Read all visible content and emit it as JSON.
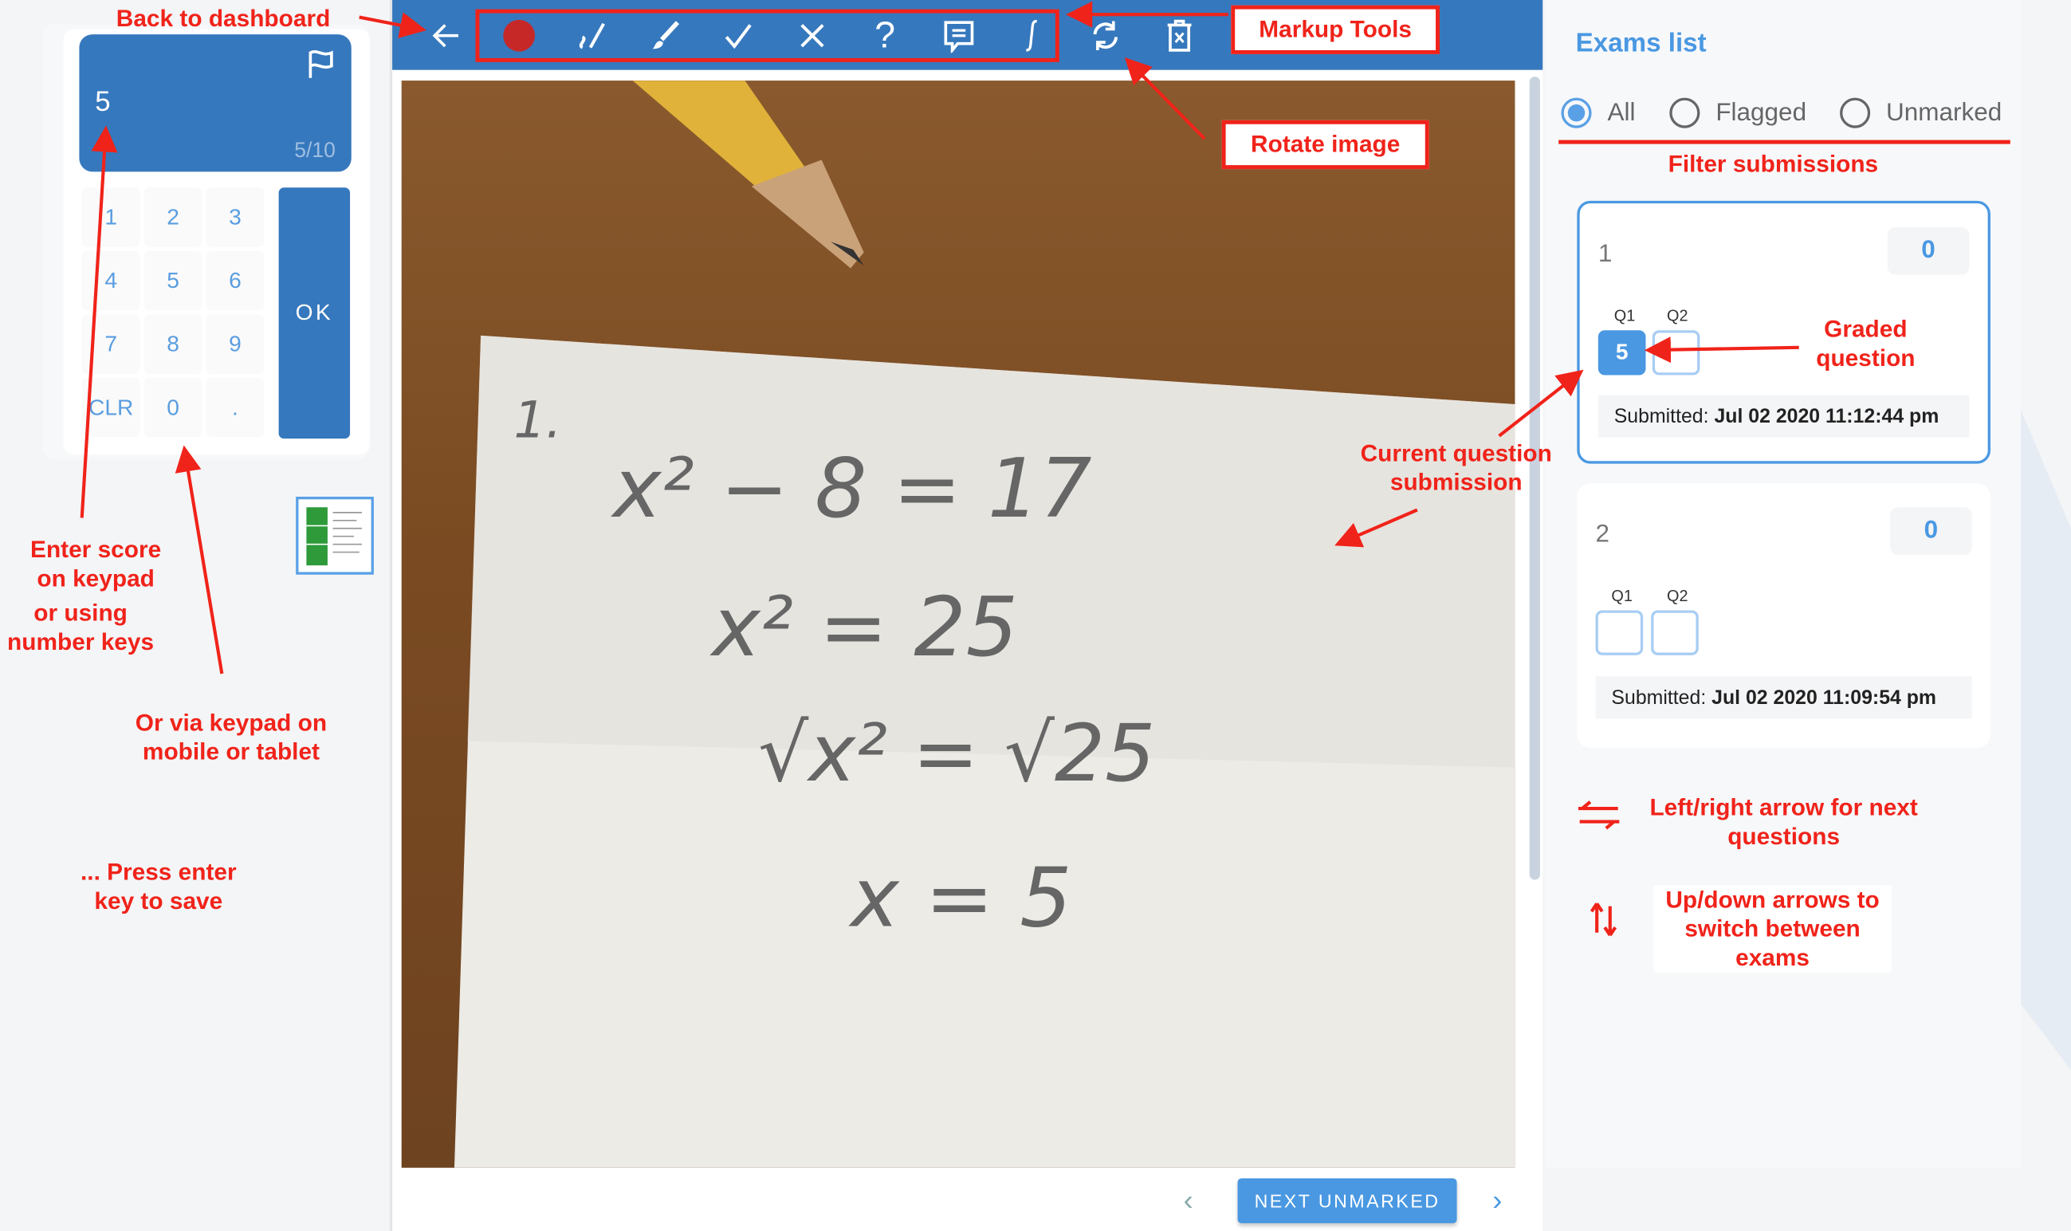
{
  "keypad": {
    "current_value": "5",
    "progress": "5/10",
    "keys": [
      "1",
      "2",
      "3",
      "4",
      "5",
      "6",
      "7",
      "8",
      "9",
      "CLR",
      "0",
      "."
    ],
    "ok_label": "OK"
  },
  "toolbar": {
    "icons": [
      "back-arrow-icon",
      "red-dot-icon",
      "check-pen-icon",
      "brush-icon",
      "check-icon",
      "cross-icon",
      "question-icon",
      "comment-icon",
      "integral-icon",
      "rotate-icon",
      "delete-icon"
    ],
    "marker_color": "#c62828"
  },
  "submission": {
    "lines": [
      "1.",
      "x² − 8 = 17",
      "x² = 25",
      "√x² = √25",
      "x = 5"
    ]
  },
  "footer": {
    "next_label": "NEXT UNMARKED"
  },
  "exams": {
    "title": "Exams list",
    "filters": [
      {
        "label": "All",
        "selected": true
      },
      {
        "label": "Flagged",
        "selected": false
      },
      {
        "label": "Unmarked",
        "selected": false
      }
    ],
    "cards": [
      {
        "number": "1",
        "score": "0",
        "questions": [
          {
            "label": "Q1",
            "value": "5",
            "graded": true
          },
          {
            "label": "Q2",
            "value": "",
            "graded": false
          }
        ],
        "submitted_label": "Submitted:",
        "submitted": "Jul 02 2020 11:12:44 pm",
        "active": true
      },
      {
        "number": "2",
        "score": "0",
        "questions": [
          {
            "label": "Q1",
            "value": "",
            "graded": false
          },
          {
            "label": "Q2",
            "value": "",
            "graded": false
          }
        ],
        "submitted_label": "Submitted:",
        "submitted": "Jul 02 2020 11:09:54 pm",
        "active": false
      }
    ]
  },
  "annotations": {
    "back": "Back to dashboard",
    "markup": "Markup Tools",
    "rotate": "Rotate image",
    "filter": "Filter submissions",
    "graded": "Graded question",
    "current": "Current question submission",
    "enter_score": "Enter score on keypad",
    "number_keys": "or using number keys",
    "mobile": "Or via keypad on mobile or tablet",
    "press_enter": "... Press enter key to save",
    "leftright": "Left/right arrow for next questions",
    "updown": "Up/down arrows to switch between exams"
  },
  "colors": {
    "primary": "#3678bd",
    "accent": "#4a98e2",
    "annotation": "#f0231a"
  }
}
